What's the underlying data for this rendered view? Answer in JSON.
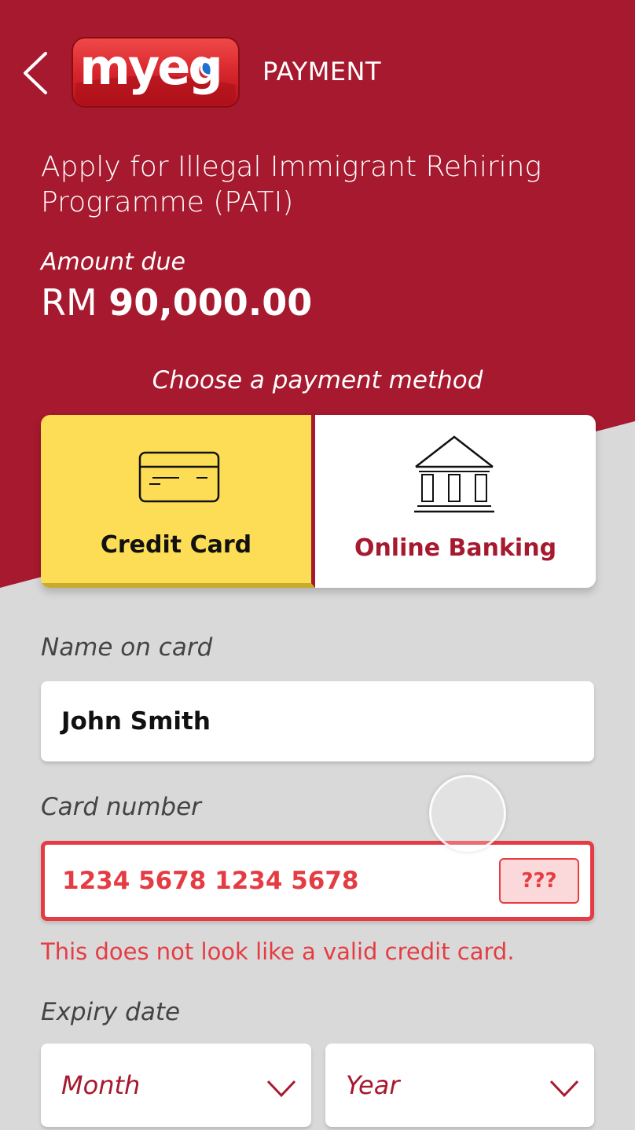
{
  "header": {
    "logo_text": "myeg",
    "title": "PAYMENT"
  },
  "service": {
    "title": "Apply for Illegal Immigrant Rehiring Programme (PATI)"
  },
  "amount": {
    "label": "Amount due",
    "currency": "RM",
    "value": "90,000.00"
  },
  "payment": {
    "choose_label": "Choose a payment method",
    "methods": [
      {
        "label": "Credit Card",
        "icon": "credit-card-icon",
        "selected": true
      },
      {
        "label": "Online Banking",
        "icon": "bank-icon",
        "selected": false
      }
    ]
  },
  "form": {
    "name_label": "Name on card",
    "name_value": "John Smith",
    "card_label": "Card number",
    "card_value": "1234 5678 1234 5678",
    "cvv_placeholder": "???",
    "card_error": "This does not look like a valid credit card.",
    "expiry_label": "Expiry date",
    "month_placeholder": "Month",
    "year_placeholder": "Year"
  },
  "colors": {
    "brand_red": "#a6192e",
    "selected_tab": "#fddd55",
    "error": "#e53c43",
    "background": "#d9d9d9"
  }
}
